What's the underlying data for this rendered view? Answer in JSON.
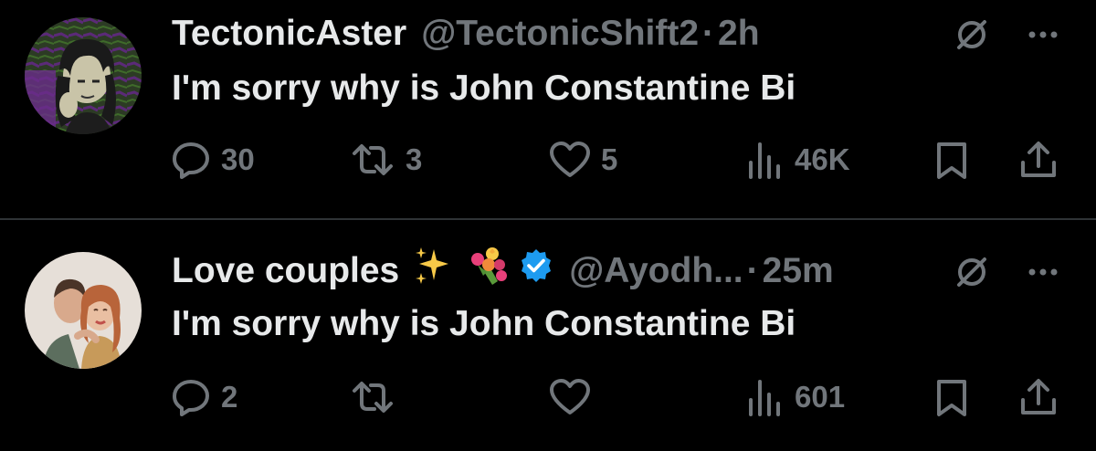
{
  "colors": {
    "background": "#000000",
    "text_primary": "#e7e9ea",
    "text_secondary": "#71767b",
    "divider": "#2f3336",
    "verified_badge": "#1d9bf0"
  },
  "tweets": [
    {
      "display_name": "TectonicAster",
      "handle": "@TectonicShift2",
      "separator": "·",
      "time": "2h",
      "text": "I'm sorry why is John Constantine Bi",
      "verified": false,
      "emojis": [],
      "avatar": "dark-green-purple-cartoon-avatar",
      "actions": {
        "reply_count": "30",
        "retweet_count": "3",
        "like_count": "5",
        "view_count": "46K"
      },
      "icons": [
        "grok-icon",
        "more-icon",
        "reply-icon",
        "retweet-icon",
        "like-icon",
        "views-icon",
        "bookmark-icon",
        "share-icon"
      ]
    },
    {
      "display_name": "Love couples",
      "handle": "@Ayodh...",
      "separator": "·",
      "time": "25m",
      "text": "I'm sorry why is John Constantine Bi",
      "verified": true,
      "emojis": [
        "sparkles-emoji",
        "bouquet-emoji"
      ],
      "avatar": "couple-illustration-avatar",
      "actions": {
        "reply_count": "2",
        "retweet_count": "",
        "like_count": "",
        "view_count": "601"
      },
      "icons": [
        "grok-icon",
        "more-icon",
        "reply-icon",
        "retweet-icon",
        "like-icon",
        "views-icon",
        "bookmark-icon",
        "share-icon"
      ]
    }
  ]
}
